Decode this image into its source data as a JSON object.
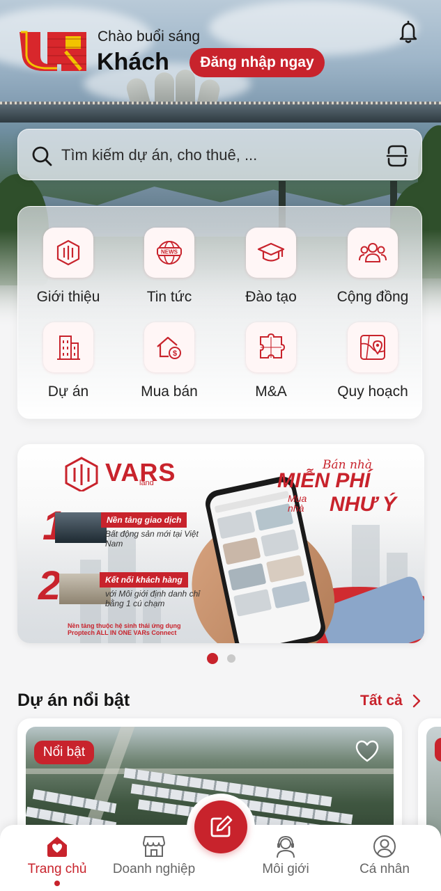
{
  "header": {
    "greeting": "Chào buổi sáng",
    "username": "Khách",
    "login_label": "Đăng nhập ngay"
  },
  "search": {
    "placeholder": "Tìm kiếm dự án, cho thuê, ..."
  },
  "menu": {
    "items": [
      {
        "label": "Giới thiệu",
        "icon": "about-icon"
      },
      {
        "label": "Tin tức",
        "icon": "news-icon"
      },
      {
        "label": "Đào tạo",
        "icon": "graduation-cap-icon"
      },
      {
        "label": "Cộng đồng",
        "icon": "community-icon"
      },
      {
        "label": "Dự án",
        "icon": "building-icon"
      },
      {
        "label": "Mua bán",
        "icon": "house-money-icon"
      },
      {
        "label": "M&A",
        "icon": "puzzle-icon"
      },
      {
        "label": "Quy hoạch",
        "icon": "map-pin-icon"
      }
    ]
  },
  "banner": {
    "brand": "VARS",
    "brand_sub": "land",
    "slogan_line1": "Bán nhà",
    "slogan_line2": "MIỄN PHÍ",
    "slogan_line3": "Mua nhà",
    "slogan_line4": "NHƯ Ý",
    "feature1_num": "1",
    "feature1_title": "Nền tảng giao dịch",
    "feature1_desc": "Bất động sản mới tại Việt Nam",
    "feature2_num": "2",
    "feature2_title": "Kết nối khách hàng",
    "feature2_desc": "với Môi giới định danh chỉ bằng 1 cú chạm",
    "footer_line1": "Nền tảng thuộc hệ sinh thái ứng dụng",
    "footer_line2": "Proptech ALL IN ONE VARs Connect",
    "pages_total": 2,
    "active_page": 1
  },
  "section": {
    "title": "Dự án nổi bật",
    "see_all_label": "Tất cả"
  },
  "project_card": {
    "badge": "Nổi bật"
  },
  "bottom_nav": {
    "items": [
      {
        "label": "Trang chủ",
        "icon": "home-icon",
        "active": true
      },
      {
        "label": "Doanh nghiệp",
        "icon": "store-icon",
        "active": false
      },
      {
        "label": "Môi giới",
        "icon": "agent-headset-icon",
        "active": false
      },
      {
        "label": "Cá nhân",
        "icon": "user-circle-icon",
        "active": false
      }
    ],
    "center_action_icon": "edit-icon"
  },
  "colors": {
    "accent": "#c8232c",
    "text": "#1e1e1e",
    "muted": "#666666"
  }
}
